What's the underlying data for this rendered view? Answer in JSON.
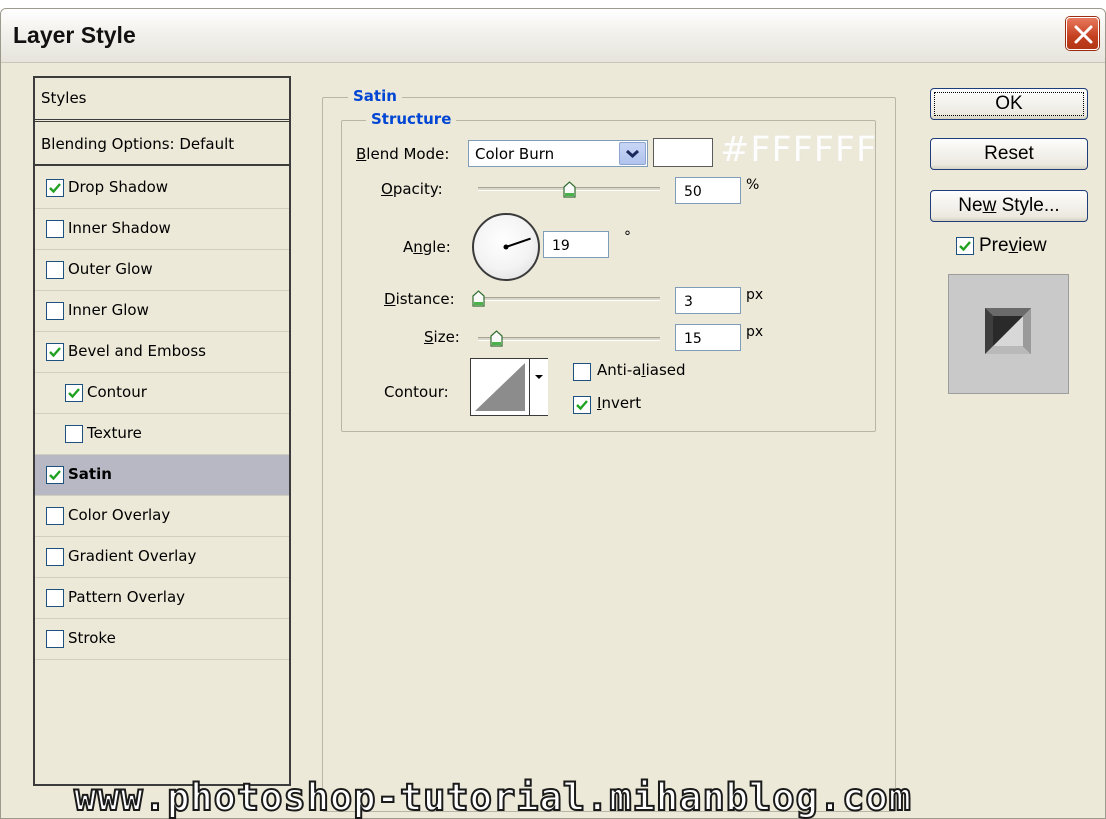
{
  "window": {
    "title": "Layer Style"
  },
  "styles_panel": {
    "header": "Styles",
    "blending_options": "Blending Options: Default",
    "items": [
      {
        "label": "Drop Shadow",
        "checked": true,
        "indent": false,
        "selected": false
      },
      {
        "label": "Inner Shadow",
        "checked": false,
        "indent": false,
        "selected": false
      },
      {
        "label": "Outer Glow",
        "checked": false,
        "indent": false,
        "selected": false
      },
      {
        "label": "Inner Glow",
        "checked": false,
        "indent": false,
        "selected": false
      },
      {
        "label": "Bevel and Emboss",
        "checked": true,
        "indent": false,
        "selected": false
      },
      {
        "label": "Contour",
        "checked": true,
        "indent": true,
        "selected": false
      },
      {
        "label": "Texture",
        "checked": false,
        "indent": true,
        "selected": false
      },
      {
        "label": "Satin",
        "checked": true,
        "indent": false,
        "selected": true
      },
      {
        "label": "Color Overlay",
        "checked": false,
        "indent": false,
        "selected": false
      },
      {
        "label": "Gradient Overlay",
        "checked": false,
        "indent": false,
        "selected": false
      },
      {
        "label": "Pattern Overlay",
        "checked": false,
        "indent": false,
        "selected": false
      },
      {
        "label": "Stroke",
        "checked": false,
        "indent": false,
        "selected": false
      }
    ]
  },
  "satin": {
    "legend": "Satin",
    "structure_legend": "Structure",
    "blend_mode": {
      "label_u": "B",
      "label_rest": "lend Mode:",
      "value": "Color Burn"
    },
    "color": "#FFFFFF",
    "color_hex_label": "#FFFFFF",
    "opacity": {
      "label_u": "O",
      "label_rest": "pacity:",
      "value": "50",
      "unit": "%",
      "fraction": 0.5
    },
    "angle": {
      "label_pre": "A",
      "label_u": "n",
      "label_rest": "gle:",
      "value": "19",
      "unit": "°"
    },
    "distance": {
      "label_u": "D",
      "label_rest": "istance:",
      "value": "3",
      "unit": "px",
      "fraction": 0.0
    },
    "size": {
      "label_u": "S",
      "label_rest": "ize:",
      "value": "15",
      "unit": "px",
      "fraction": 0.1
    },
    "contour_label": "Contour:",
    "anti_aliased": {
      "label_pre": "Anti-a",
      "label_u": "l",
      "label_rest": "iased",
      "checked": false
    },
    "invert": {
      "label_u": "I",
      "label_rest": "nvert",
      "checked": true
    }
  },
  "buttons": {
    "ok": "OK",
    "reset": "Reset",
    "new_style_pre": "Ne",
    "new_style_u": "w",
    "new_style_rest": " Style...",
    "preview_pre": "Pre",
    "preview_u": "v",
    "preview_rest": "iew",
    "preview_checked": true
  },
  "watermark": "www.photoshop-tutorial.mihanblog.com",
  "colors": {
    "accent": "#0046d5",
    "checkmark": "#21a121",
    "selected_row": "#b7b8c3",
    "dialog_bg": "#ece9d8"
  }
}
